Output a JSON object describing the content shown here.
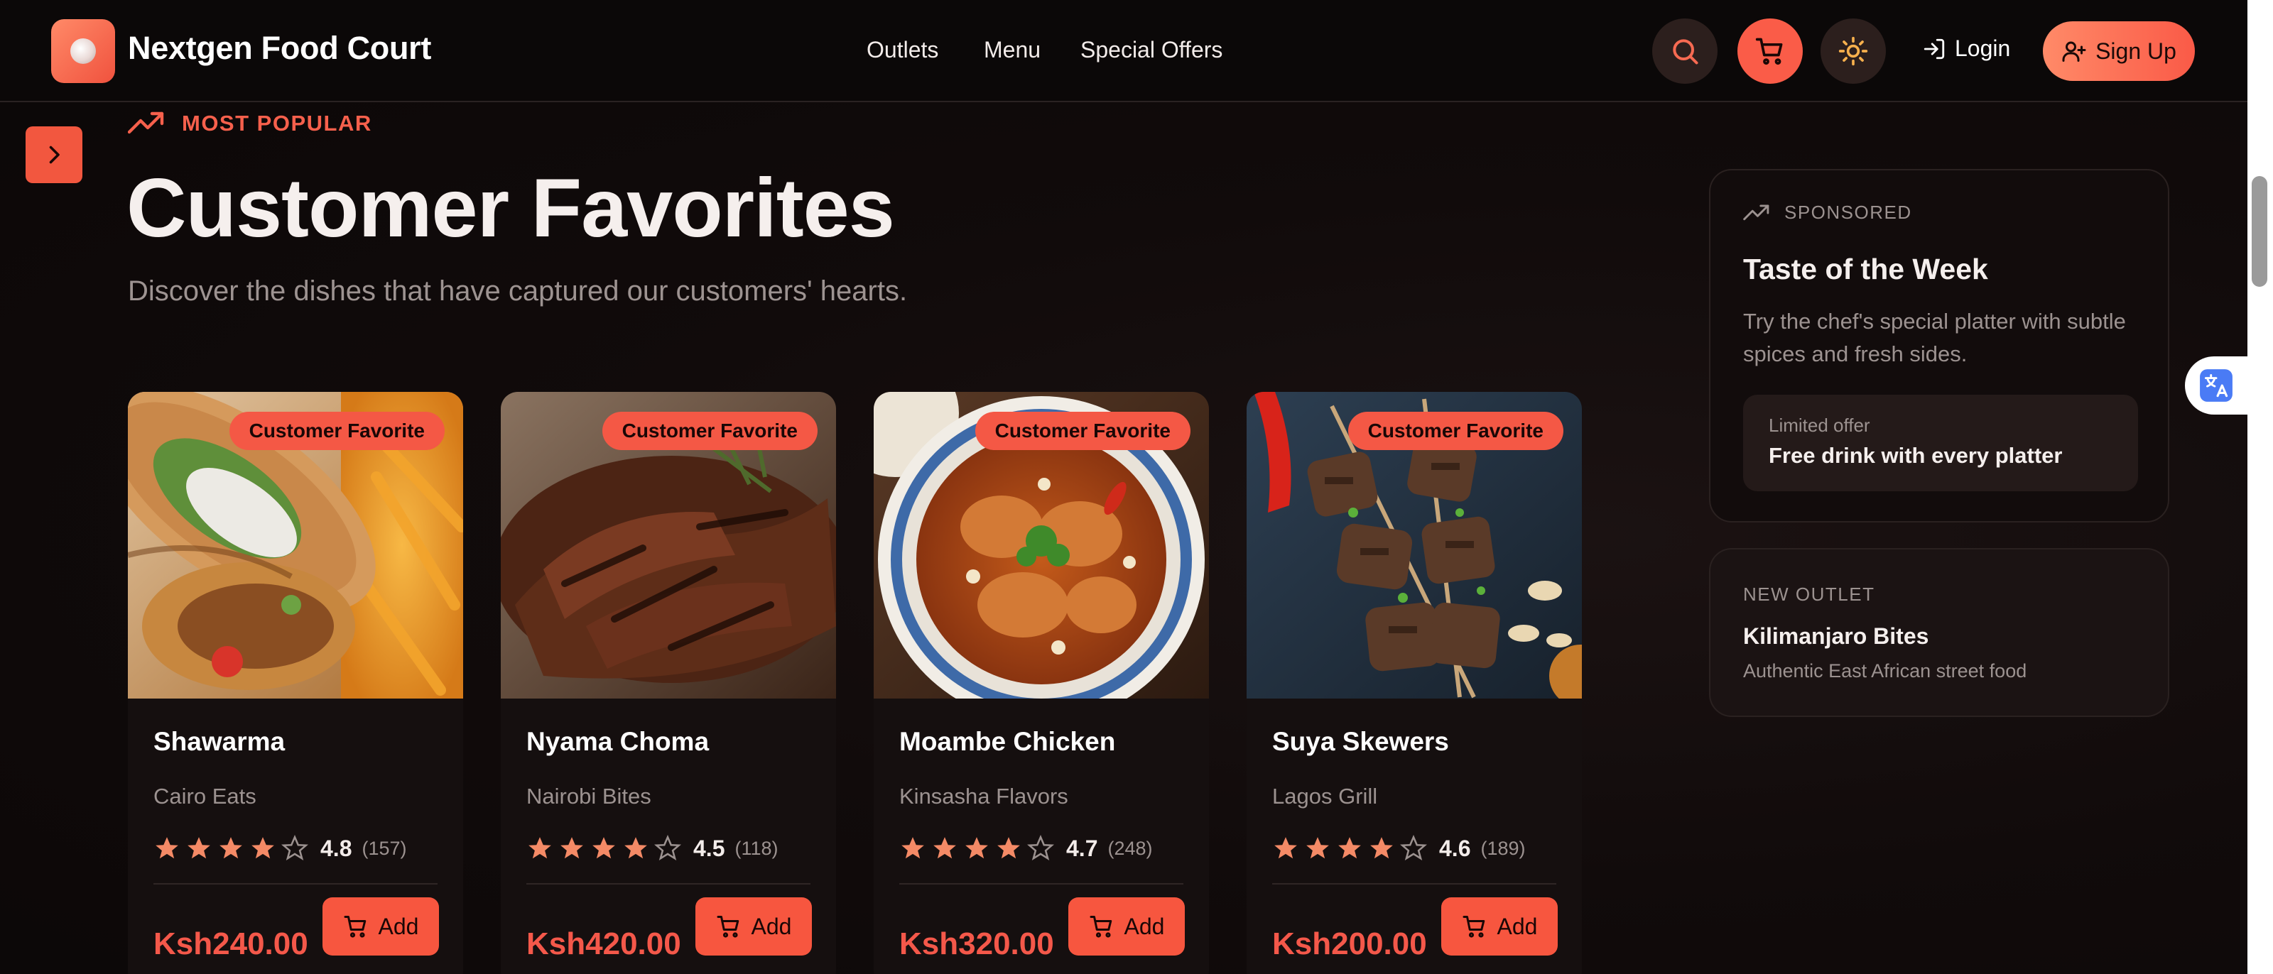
{
  "header": {
    "brand": "Nextgen Food Court",
    "nav": [
      "Outlets",
      "Menu",
      "Special Offers"
    ],
    "login_label": "Login",
    "signup_label": "Sign Up",
    "icons": [
      "search-icon",
      "cart-icon",
      "sun-icon",
      "login-icon",
      "user-plus-icon"
    ],
    "accent_color": "#fa5c48"
  },
  "hero": {
    "eyebrow": "MOST POPULAR",
    "title": "Customer Favorites",
    "subtitle": "Discover the dishes that have captured our customers' hearts."
  },
  "products": [
    {
      "badge": "Customer Favorite",
      "name": "Shawarma",
      "outlet": "Cairo Eats",
      "rating": "4.8",
      "rating_value": 4.8,
      "reviews": "(157)",
      "price": "Ksh240.00",
      "add_label": "Add",
      "image": "shawarma-wrap"
    },
    {
      "badge": "Customer Favorite",
      "name": "Nyama Choma",
      "outlet": "Nairobi Bites",
      "rating": "4.5",
      "rating_value": 4.5,
      "reviews": "(118)",
      "price": "Ksh420.00",
      "add_label": "Add",
      "image": "grilled-beef"
    },
    {
      "badge": "Customer Favorite",
      "name": "Moambe Chicken",
      "outlet": "Kinsasha Flavors",
      "rating": "4.7",
      "rating_value": 4.7,
      "reviews": "(248)",
      "price": "Ksh320.00",
      "add_label": "Add",
      "image": "chicken-stew-bowl"
    },
    {
      "badge": "Customer Favorite",
      "name": "Suya Skewers",
      "outlet": "Lagos Grill",
      "rating": "4.6",
      "rating_value": 4.6,
      "reviews": "(189)",
      "price": "Ksh200.00",
      "add_label": "Add",
      "image": "meat-skewers"
    }
  ],
  "sidebar": {
    "sponsored": {
      "eyebrow": "SPONSORED",
      "title": "Taste of the Week",
      "description": "Try the chef's special platter with subtle spices and fresh sides.",
      "offer_label": "Limited offer",
      "offer_value": "Free drink with every platter"
    },
    "new_outlet": {
      "eyebrow": "NEW OUTLET",
      "name": "Kilimanjaro Bites",
      "description": "Authentic East African street food"
    }
  }
}
